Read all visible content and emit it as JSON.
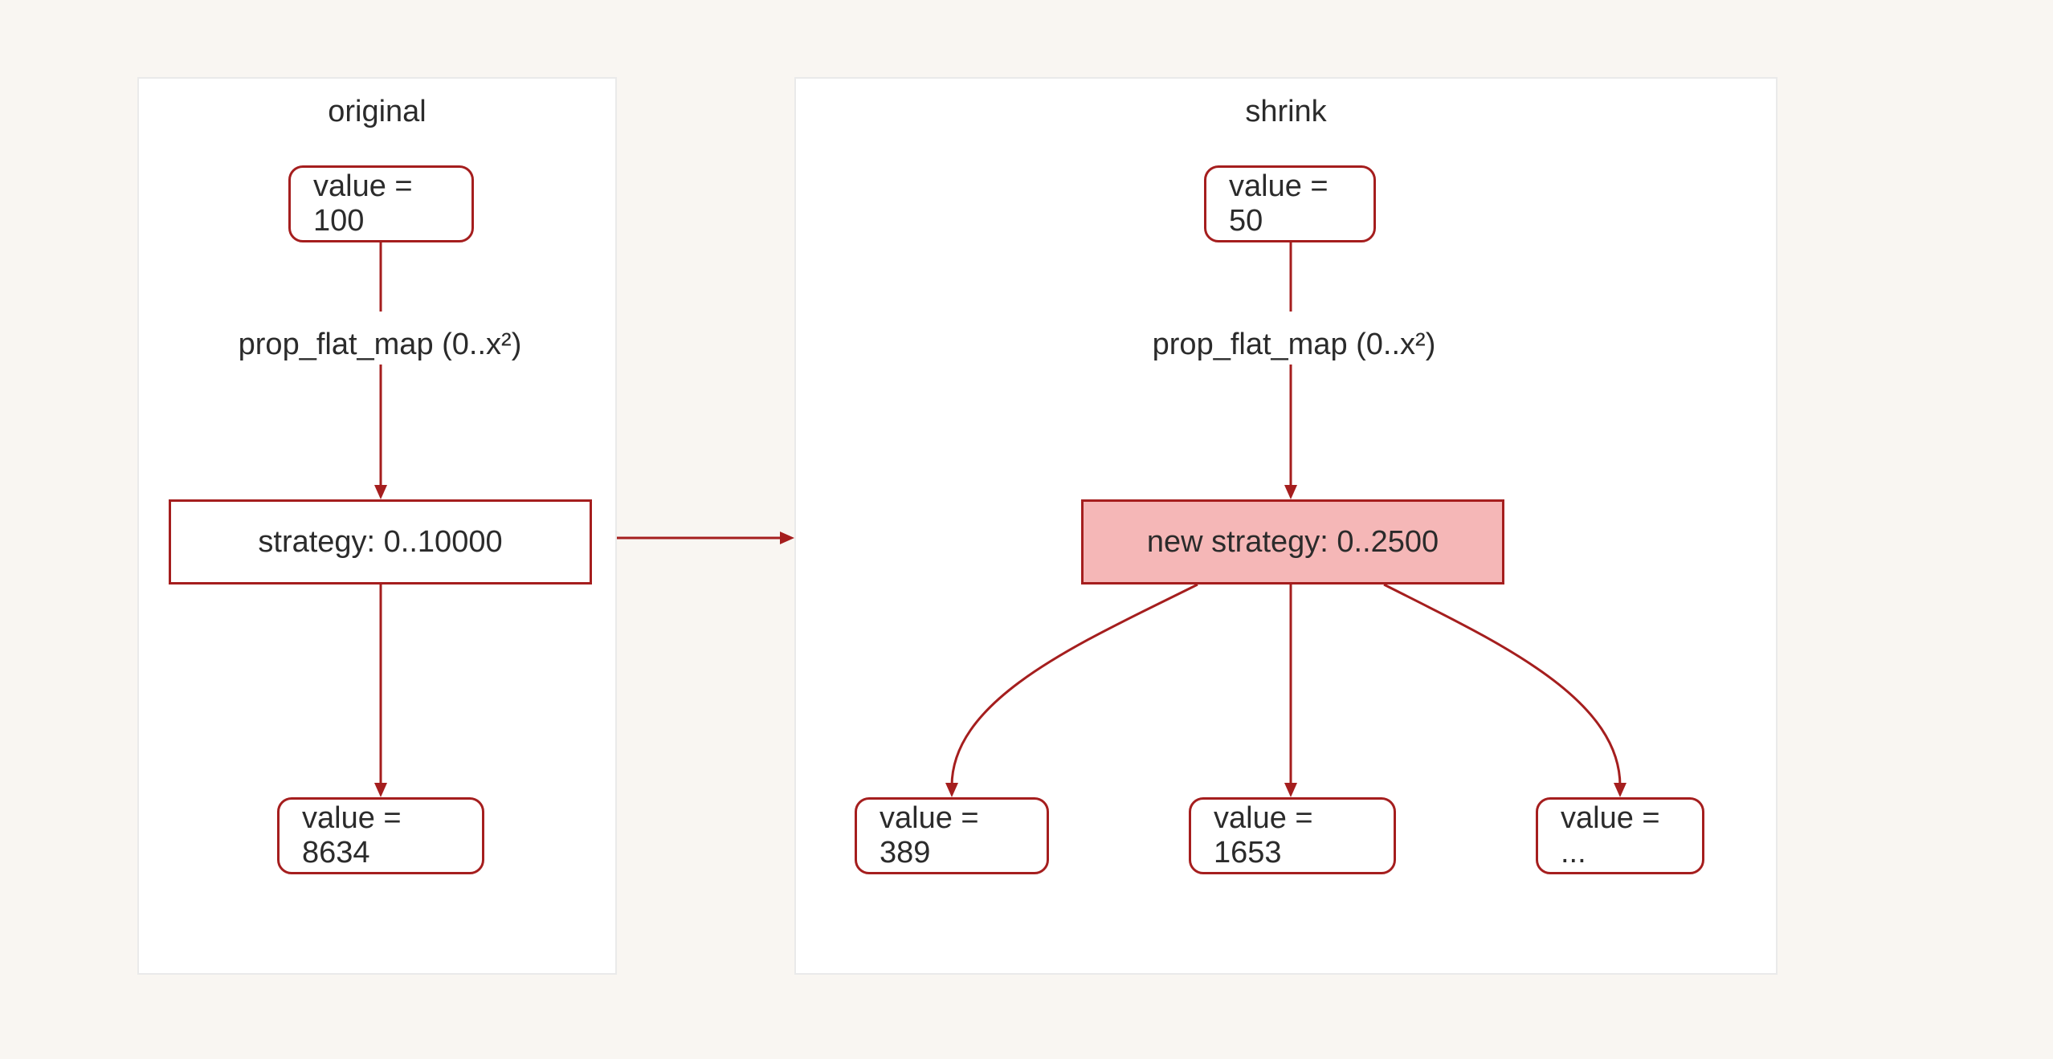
{
  "colors": {
    "accent": "#A51E1E",
    "fill": "#F5B7B7",
    "bg": "#F9F6F2"
  },
  "left": {
    "title": "original",
    "value_top": "value = 100",
    "edge": "prop_flat_map (0..x²)",
    "strategy": "strategy: 0..10000",
    "value_bottom": "value = 8634"
  },
  "right": {
    "title": "shrink",
    "value_top": "value = 50",
    "edge": "prop_flat_map (0..x²)",
    "strategy": "new strategy: 0..2500",
    "v1": "value = 389",
    "v2": "value = 1653",
    "v3": "value = ..."
  }
}
